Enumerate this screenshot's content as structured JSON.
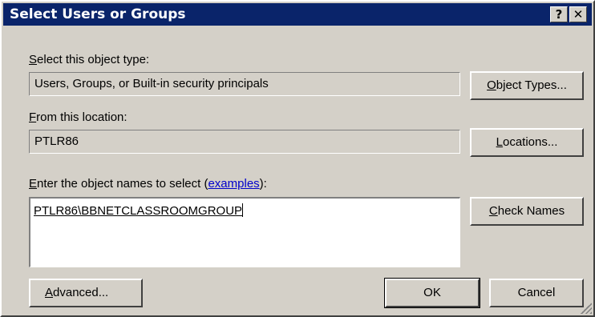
{
  "window": {
    "title": "Select Users or Groups",
    "help_glyph": "?",
    "close_glyph": "✕"
  },
  "object_type": {
    "label_mnemonic": "S",
    "label_rest": "elect this object type:",
    "value": "Users, Groups, or Built-in security principals",
    "button_mnemonic": "O",
    "button_rest": "bject Types..."
  },
  "location": {
    "label_mnemonic": "F",
    "label_rest": "rom this location:",
    "value": "PTLR86",
    "button_mnemonic": "L",
    "button_rest": "ocations..."
  },
  "names": {
    "label_mnemonic": "E",
    "label_rest": "nter the object names to select (",
    "link_text": "examples",
    "label_suffix": "):",
    "value": "PTLR86\\BBNETCLASSROOMGROUP",
    "check_button_mnemonic": "C",
    "check_button_rest": "heck Names"
  },
  "footer": {
    "advanced_mnemonic": "A",
    "advanced_rest": "dvanced...",
    "ok_label": "OK",
    "cancel_label": "Cancel"
  }
}
